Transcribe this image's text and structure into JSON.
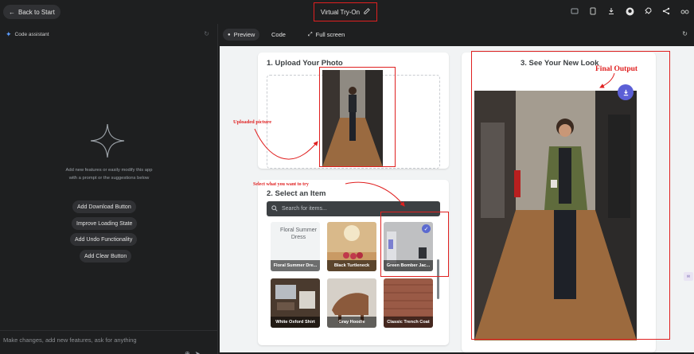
{
  "header": {
    "back_label": "Back to Start",
    "app_title": "Virtual Try-On",
    "icons": [
      "screenshot-icon",
      "device-icon",
      "download-icon",
      "github-icon",
      "rocket-icon",
      "share-icon",
      "settings-icon"
    ]
  },
  "assistant": {
    "title": "Code assistant",
    "suggest_text": "Add new features or easily modify this app with a prompt or the suggestions below",
    "suggestions": [
      "Add Download Button",
      "Improve Loading State",
      "Add Undo Functionality",
      "Add Clear Button"
    ],
    "prompt_placeholder": "Make changes, add new features, ask for anything"
  },
  "tabs": {
    "preview": "Preview",
    "code": "Code",
    "fullscreen": "Full screen"
  },
  "app": {
    "upload_title": "1. Upload Your Photo",
    "select_title": "2. Select an Item",
    "search_placeholder": "Search for items...",
    "result_title": "3. See Your New Look",
    "items": [
      {
        "label": "Floral Summer Dre...",
        "alt": "Floral Summer Dress"
      },
      {
        "label": "Black Turtleneck"
      },
      {
        "label": "Green Bomber Jac...",
        "selected": true
      },
      {
        "label": "White Oxford Shirt"
      },
      {
        "label": "Gray Hoodie"
      },
      {
        "label": "Classic Trench Coat"
      }
    ]
  },
  "annotations": {
    "uploaded": "Uploaded picture",
    "select": "Select what you want to try",
    "final": "Final Output"
  },
  "colors": {
    "annotation_red": "#e02020",
    "accent": "#5b5fd6"
  }
}
